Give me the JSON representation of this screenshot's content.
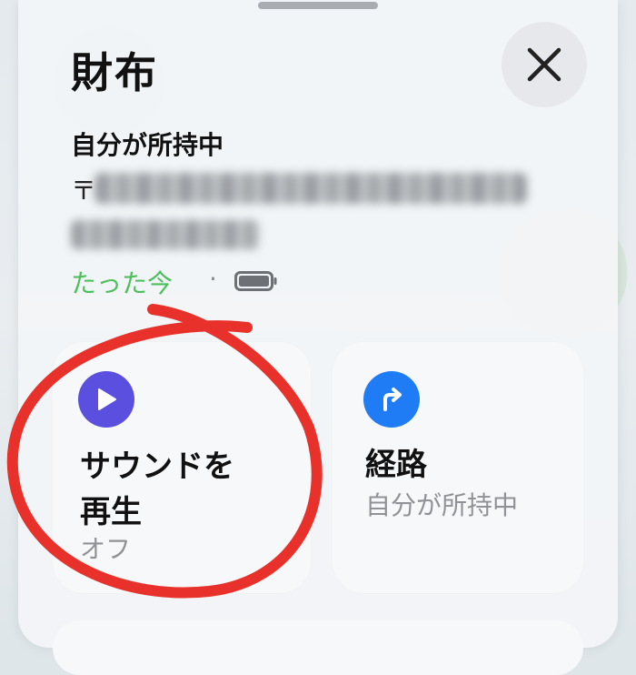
{
  "title": "財布",
  "close_label": "×",
  "owner_status": "自分が所持中",
  "address_prefix": "〒",
  "last_seen": "たった今",
  "separator": "·",
  "battery_icon": "battery-full-icon",
  "actions": [
    {
      "title": "サウンドを再生",
      "subtitle": "オフ",
      "icon": "play-icon",
      "icon_color": "#5b4fe0"
    },
    {
      "title": "経路",
      "subtitle": "自分が所持中",
      "icon": "turn-right-arrow-icon",
      "icon_color": "#1f7cf4"
    }
  ],
  "colors": {
    "accent_green": "#4cbe5a",
    "annotation_red": "#e8312a"
  }
}
